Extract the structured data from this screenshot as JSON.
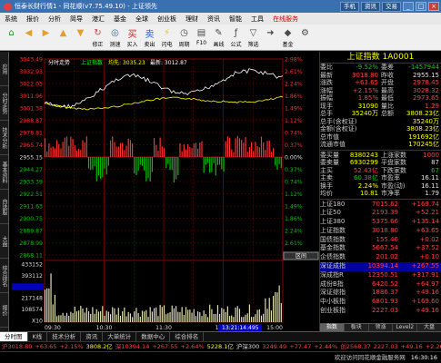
{
  "window": {
    "title": "恒泰长财行情1 - 同花顺(v7.75.49.10) - 上证领先",
    "top_buttons": [
      "手机",
      "资讯",
      "交易"
    ],
    "controls": [
      "_",
      "□",
      "×"
    ]
  },
  "menu": [
    "系统",
    "报价",
    "分析",
    "简导",
    "港汇",
    "基金",
    "全球",
    "创业板",
    "理财",
    "资讯",
    "智能",
    "工具",
    "在线服务"
  ],
  "toolbar": [
    {
      "label": "",
      "icon": "home-icon",
      "color": "#2a8a2a"
    },
    {
      "label": "",
      "icon": "back-icon",
      "color": "#e0a030"
    },
    {
      "label": "",
      "icon": "forward-icon",
      "color": "#e0a030"
    },
    {
      "label": "",
      "icon": "up-icon",
      "color": "#e0a030"
    },
    {
      "label": "",
      "icon": "down-icon",
      "color": "#e0a030"
    },
    {
      "label": "修正",
      "icon": "refresh-icon",
      "color": "#d04040"
    },
    {
      "label": "测速",
      "icon": "speed-icon",
      "color": "#3060c0"
    },
    {
      "label": "买入",
      "icon": "buy-icon",
      "color": "#d02020"
    },
    {
      "label": "卖出",
      "icon": "sell-icon",
      "color": "#2060d0"
    },
    {
      "label": "闪电",
      "icon": "flash-icon",
      "color": "#e0c020"
    },
    {
      "label": "周期",
      "icon": "period-icon",
      "color": "#4a4a4a"
    },
    {
      "label": "F10",
      "icon": "f10-icon",
      "color": "#4a4a4a"
    },
    {
      "label": "画线",
      "icon": "draw-icon",
      "color": "#4a4a4a"
    },
    {
      "label": "公式",
      "icon": "formula-icon",
      "color": "#4a4a4a"
    },
    {
      "label": "筛选",
      "icon": "filter-icon",
      "color": "#4a4a4a"
    },
    {
      "label": "",
      "icon": "arrow-right-icon",
      "color": "#4a4a4a"
    },
    {
      "label": "基金",
      "icon": "fund-icon",
      "color": "#4a4a4a"
    },
    {
      "label": "",
      "icon": "gear-icon",
      "color": "#4a4a4a"
    }
  ],
  "side_tabs": [
    "应用",
    "分时走势",
    "技术分析",
    "基本资料",
    "自选股",
    "大盘",
    "综合排名",
    "报价"
  ],
  "chart": {
    "header": {
      "prefix": "分时走势",
      "name": "上证指数",
      "avg_label": "均先:",
      "avg": "3035.23",
      "last_label": "最新:",
      "last": "3012.87"
    },
    "price_ticks": [
      "3043.49",
      "3032.93",
      "3022.05",
      "3011.96",
      "3001.38",
      "2988.87",
      "2978.81",
      "2965.74",
      "2955.15",
      "2944.27",
      "2933.39",
      "2922.51",
      "2911.63",
      "2900.75",
      "2889.87",
      "2878.99",
      "2868.11"
    ],
    "pct_ticks": [
      "2.98%",
      "2.61%",
      "2.24%",
      "1.86%",
      "1.49%",
      "1.12%",
      "0.74%",
      "0.37%",
      "0.00%",
      "0.37%",
      "0.74%",
      "1.12%",
      "1.49%",
      "1.86%",
      "2.24%",
      "2.61%",
      "2.98%"
    ],
    "vol_ticks": [
      "433152",
      "393112",
      "325722",
      "217148",
      "108574",
      "X10"
    ],
    "time_ticks": [
      "09:30",
      "10:30",
      "11:30",
      "14:00",
      "15:00"
    ],
    "cursor_time": "13:21:14:495",
    "cursor_price": "3012.87",
    "side_label": "区间",
    "colors": {
      "up": "#ff3030",
      "down": "#00c000",
      "price": "#ffffff",
      "avg": "#ffff00",
      "grid": "#8a0000"
    }
  },
  "quote": {
    "title": "上证指数 1A0001",
    "rows": [
      {
        "a": "委比",
        "b": "-9.52%",
        "bc": "dn",
        "c": "委差",
        "d": "-1457944",
        "dc": "dn"
      },
      {
        "a": "最新",
        "b": "3018.80",
        "bc": "up",
        "c": "昨收",
        "d": "2955.15",
        "dc": "wh"
      },
      {
        "a": "涨跌",
        "b": "+63.65",
        "bc": "up",
        "c": "开盘",
        "d": "2978.45",
        "dc": "up"
      },
      {
        "a": "涨幅",
        "b": "+2.15%",
        "bc": "up",
        "c": "最高",
        "d": "3028.32",
        "dc": "up"
      },
      {
        "a": "振幅",
        "b": "1.85%",
        "bc": "up",
        "c": "最低",
        "d": "2973.65",
        "dc": "up"
      },
      {
        "a": "现手",
        "b": "31090",
        "bc": "yl",
        "c": "量比",
        "d": "1.29",
        "dc": "up"
      },
      {
        "a": "总手",
        "b": "35240万",
        "bc": "yl",
        "c": "总额",
        "d": "3808.23亿",
        "dc": "yl"
      },
      {
        "a": "总手(含权证)",
        "b": "",
        "bc": "yl",
        "c": "",
        "d": "35240万",
        "dc": "yl"
      },
      {
        "a": "金额(含权证)",
        "b": "",
        "bc": "yl",
        "c": "",
        "d": "3808.23亿",
        "dc": "yl"
      },
      {
        "a": "总市值",
        "b": "",
        "bc": "yl",
        "c": "",
        "d": "191692亿",
        "dc": "yl"
      },
      {
        "a": "流通市值",
        "b": "",
        "bc": "yl",
        "c": "",
        "d": "170245亿",
        "dc": "yl"
      }
    ],
    "rows2": [
      {
        "a": "委买量",
        "b": "8380243",
        "bc": "yl",
        "c": "上涨家数",
        "d": "1000",
        "dc": "up"
      },
      {
        "a": "委卖量",
        "b": "6930299",
        "bc": "yl",
        "c": "平盘家数",
        "d": "87",
        "dc": "wh"
      },
      {
        "a": "主买",
        "b": "52.43亿",
        "bc": "up",
        "c": "下跌家数",
        "d": "67",
        "dc": "dn"
      },
      {
        "a": "主卖",
        "b": "60.38亿",
        "bc": "dn",
        "c": "市盈率",
        "d": "16.11",
        "dc": "wh"
      },
      {
        "a": "换手",
        "b": "2.24%",
        "bc": "yl",
        "c": "市盈(动)",
        "d": "16.11",
        "dc": "wh"
      },
      {
        "a": "均价",
        "b": "10.81",
        "bc": "yl",
        "c": "市净率",
        "d": "1.79",
        "dc": "wh"
      }
    ],
    "indices": [
      {
        "n": "上证180",
        "p": "7015.62",
        "ch": "+169.74",
        "sel": false
      },
      {
        "n": "上证50",
        "p": "2193.39",
        "ch": "+52.21",
        "sel": false
      },
      {
        "n": "上证380",
        "p": "5375.66",
        "ch": "+135.14",
        "sel": false
      },
      {
        "n": "上证指数",
        "p": "3018.80",
        "ch": "+63.65",
        "sel": false
      },
      {
        "n": "国债指数",
        "p": "155.46",
        "ch": "+0.02",
        "sel": false
      },
      {
        "n": "基金指数",
        "p": "5667.54",
        "ch": "+37.52",
        "sel": false
      },
      {
        "n": "企债指数",
        "p": "201.02",
        "ch": "+0.10",
        "sel": false
      },
      {
        "n": "深证成指",
        "p": "10394.14",
        "ch": "+267.55",
        "sel": true
      },
      {
        "n": "深成指R",
        "p": "12350.51",
        "ch": "+317.91",
        "sel": false
      },
      {
        "n": "成份B指",
        "p": "6420.52",
        "ch": "+64.97",
        "sel": false
      },
      {
        "n": "深证综指",
        "p": "1886.37",
        "ch": "+49.16",
        "sel": false
      },
      {
        "n": "中小板指",
        "p": "6801.93",
        "ch": "+169.60",
        "sel": false
      },
      {
        "n": "创业板指",
        "p": "2227.03",
        "ch": "+49.16",
        "sel": false
      }
    ],
    "tabs": [
      "指数",
      "板块",
      "领涨",
      "Level2",
      "大盘"
    ]
  },
  "bottom_tabs": [
    "分时图",
    "K线",
    "技术分析",
    "资讯",
    "大单统计",
    "数据中心",
    "综合排名"
  ],
  "ticker": [
    {
      "t": "沪3018.80",
      "c": "up"
    },
    {
      "t": "+63.65",
      "c": "up"
    },
    {
      "t": "+2.15%",
      "c": "up"
    },
    {
      "t": "3808.2亿",
      "c": "yl"
    },
    {
      "t": "深10394.14",
      "c": "up"
    },
    {
      "t": "+267.55",
      "c": "up"
    },
    {
      "t": "+2.64%",
      "c": "up"
    },
    {
      "t": "5228.1亿",
      "c": "yl"
    },
    {
      "t": "沪深300",
      "c": "wh"
    },
    {
      "t": "3249.49",
      "c": "up"
    },
    {
      "t": "+77.47",
      "c": "up"
    },
    {
      "t": "+2.44%",
      "c": "up"
    },
    {
      "t": "创2568.37",
      "c": "up"
    },
    {
      "t": "2227.03",
      "c": "up"
    },
    {
      "t": "+49.16",
      "c": "up"
    },
    {
      "t": "+2.26%",
      "c": "up"
    }
  ],
  "status": {
    "text": "欢迎访问同花顺金融服务网",
    "time": "16:30:16"
  }
}
